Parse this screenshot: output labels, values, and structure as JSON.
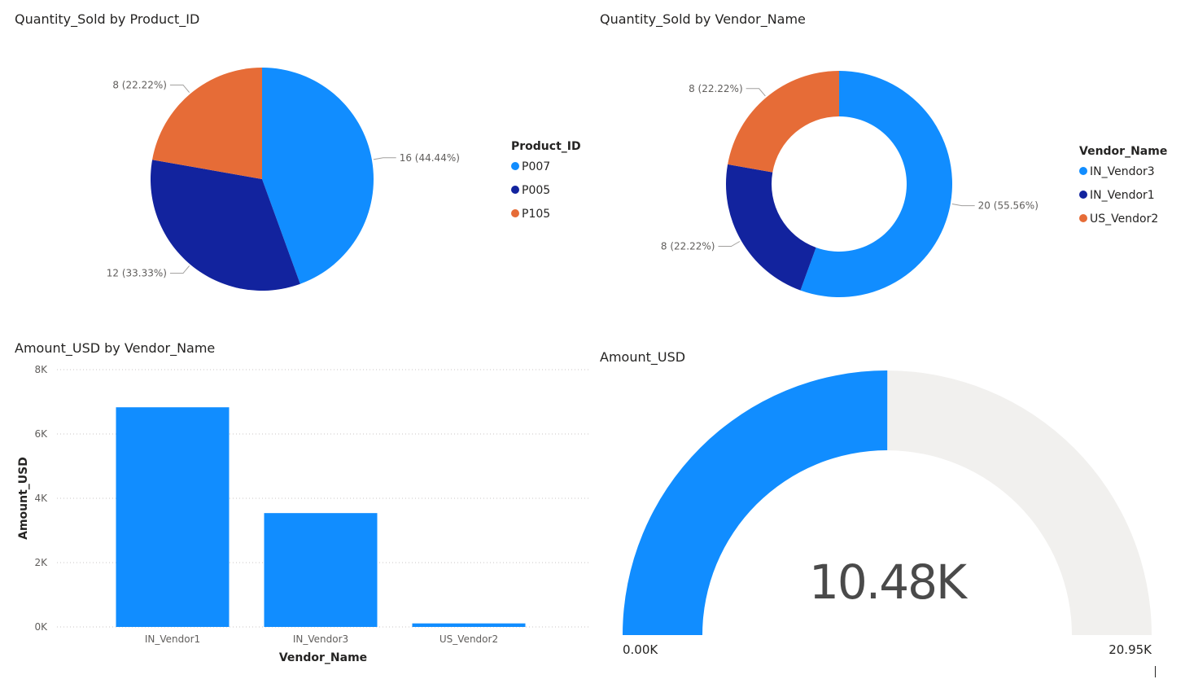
{
  "colors": {
    "blue": "#118DFF",
    "navy": "#12239E",
    "orange": "#E66C37",
    "track": "#F1F0EE",
    "grid": "#C8C6C4",
    "leader": "#A19F9D"
  },
  "chart_data": [
    {
      "type": "pie",
      "title": "Quantity_Sold by Product_ID",
      "legend_title": "Product_ID",
      "legend_position": "right",
      "slices": [
        {
          "name": "P007",
          "value": 16,
          "label": "16 (44.44%)",
          "color": "#118DFF"
        },
        {
          "name": "P005",
          "value": 12,
          "label": "12 (33.33%)",
          "color": "#12239E"
        },
        {
          "name": "P105",
          "value": 8,
          "label": "8 (22.22%)",
          "color": "#E66C37"
        }
      ]
    },
    {
      "type": "pie",
      "subtype": "donut",
      "title": "Quantity_Sold by Vendor_Name",
      "legend_title": "Vendor_Name",
      "legend_position": "right",
      "slices": [
        {
          "name": "IN_Vendor3",
          "value": 20,
          "label": "20 (55.56%)",
          "color": "#118DFF"
        },
        {
          "name": "IN_Vendor1",
          "value": 8,
          "label": "8 (22.22%)",
          "color": "#12239E"
        },
        {
          "name": "US_Vendor2",
          "value": 8,
          "label": "8 (22.22%)",
          "color": "#E66C37"
        }
      ]
    },
    {
      "type": "bar",
      "title": "Amount_USD by Vendor_Name",
      "xlabel": "Vendor_Name",
      "ylabel": "Amount_USD",
      "categories": [
        "IN_Vendor1",
        "IN_Vendor3",
        "US_Vendor2"
      ],
      "values": [
        6830,
        3540,
        110
      ],
      "ylim": [
        0,
        8000
      ],
      "yticks": [
        0,
        2000,
        4000,
        6000,
        8000
      ],
      "ytick_labels": [
        "0K",
        "2K",
        "4K",
        "6K",
        "8K"
      ],
      "grid": true,
      "color": "#118DFF"
    },
    {
      "type": "gauge",
      "title": "Amount_USD",
      "value": 10480,
      "value_label": "10.48K",
      "min": 0,
      "max": 20950,
      "min_label": "0.00K",
      "max_label": "20.95K",
      "color": "#118DFF"
    }
  ]
}
